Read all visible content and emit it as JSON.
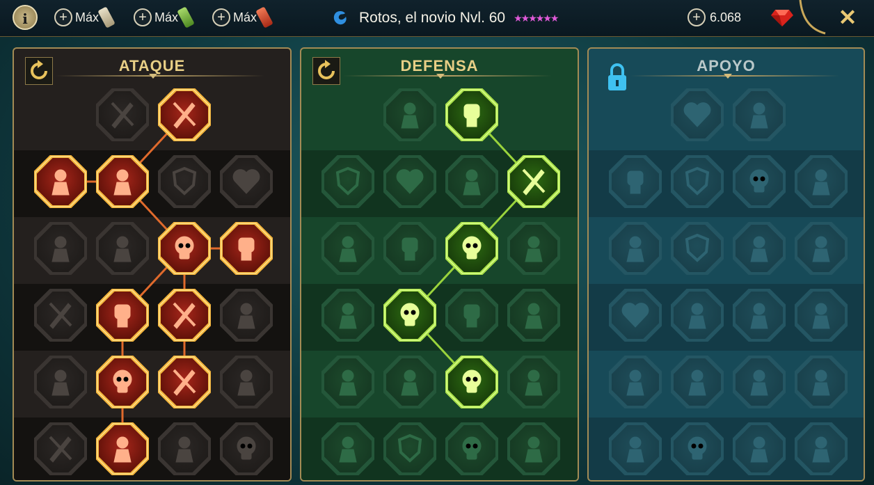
{
  "header": {
    "info_label": "i",
    "resources": [
      {
        "label": "Máx",
        "icon": "scroll-icon",
        "color": "#d8cfb6"
      },
      {
        "label": "Máx",
        "icon": "scroll-icon",
        "color": "#8bc34a"
      },
      {
        "label": "Máx",
        "icon": "scroll-icon",
        "color": "#d9432c"
      }
    ],
    "champion_icon": "affinity-icon",
    "title": "Rotos, el novio Nvl. 60",
    "stars": "★★★★★★",
    "gems": "6.068",
    "gem_icon": "ruby-icon",
    "close_label": "✕"
  },
  "trees": [
    {
      "id": "attack",
      "title": "ATAQUE",
      "has_reset": true,
      "locked": false,
      "accent": "#e06a2c",
      "nodes": [
        {
          "row": 0,
          "col": 1,
          "active": false,
          "icon": "swords-icon"
        },
        {
          "row": 0,
          "col": 2,
          "active": true,
          "icon": "dagger-strike-icon"
        },
        {
          "row": 1,
          "col": 0,
          "active": true,
          "icon": "demon-icon"
        },
        {
          "row": 1,
          "col": 1,
          "active": true,
          "icon": "triple-arrow-icon"
        },
        {
          "row": 1,
          "col": 2,
          "active": false,
          "icon": "shield-break-icon"
        },
        {
          "row": 1,
          "col": 3,
          "active": false,
          "icon": "heart-claw-icon"
        },
        {
          "row": 2,
          "col": 0,
          "active": false,
          "icon": "warrior-icon"
        },
        {
          "row": 2,
          "col": 1,
          "active": false,
          "icon": "fangs-icon"
        },
        {
          "row": 2,
          "col": 2,
          "active": true,
          "icon": "skull-slash-icon"
        },
        {
          "row": 2,
          "col": 3,
          "active": true,
          "icon": "fist-dagger-icon"
        },
        {
          "row": 3,
          "col": 0,
          "active": false,
          "icon": "sword-swirl-icon"
        },
        {
          "row": 3,
          "col": 1,
          "active": true,
          "icon": "fist-sword-icon"
        },
        {
          "row": 3,
          "col": 2,
          "active": true,
          "icon": "axe-icon"
        },
        {
          "row": 3,
          "col": 3,
          "active": false,
          "icon": "chain-lightning-icon"
        },
        {
          "row": 4,
          "col": 0,
          "active": false,
          "icon": "bow-icon"
        },
        {
          "row": 4,
          "col": 1,
          "active": true,
          "icon": "skulls-icon"
        },
        {
          "row": 4,
          "col": 2,
          "active": true,
          "icon": "sword-ring-icon"
        },
        {
          "row": 4,
          "col": 3,
          "active": false,
          "icon": "brute-icon"
        },
        {
          "row": 5,
          "col": 0,
          "active": false,
          "icon": "sword-sparkle-icon"
        },
        {
          "row": 5,
          "col": 1,
          "active": true,
          "icon": "helmet-fire-icon"
        },
        {
          "row": 5,
          "col": 2,
          "active": false,
          "icon": "demon-lord-icon"
        },
        {
          "row": 5,
          "col": 3,
          "active": false,
          "icon": "skull-crown-icon"
        }
      ],
      "links": [
        [
          0,
          2,
          1,
          1
        ],
        [
          1,
          0,
          1,
          1
        ],
        [
          1,
          1,
          2,
          2
        ],
        [
          2,
          2,
          2,
          3
        ],
        [
          2,
          2,
          3,
          1
        ],
        [
          2,
          2,
          3,
          2
        ],
        [
          3,
          1,
          4,
          1
        ],
        [
          3,
          2,
          4,
          2
        ],
        [
          4,
          1,
          5,
          1
        ]
      ]
    },
    {
      "id": "defense",
      "title": "DEFENSA",
      "has_reset": true,
      "locked": false,
      "accent": "#9ad43c",
      "nodes": [
        {
          "row": 0,
          "col": 1,
          "active": false,
          "icon": "wall-icon"
        },
        {
          "row": 0,
          "col": 2,
          "active": true,
          "icon": "fist-icon"
        },
        {
          "row": 1,
          "col": 0,
          "active": false,
          "icon": "chevron-shield-icon"
        },
        {
          "row": 1,
          "col": 1,
          "active": false,
          "icon": "heart-hand-icon"
        },
        {
          "row": 1,
          "col": 2,
          "active": false,
          "icon": "brute-icon"
        },
        {
          "row": 1,
          "col": 3,
          "active": true,
          "icon": "crossed-blades-icon"
        },
        {
          "row": 2,
          "col": 0,
          "active": false,
          "icon": "figure-icon"
        },
        {
          "row": 2,
          "col": 1,
          "active": false,
          "icon": "shield-hand-icon"
        },
        {
          "row": 2,
          "col": 2,
          "active": true,
          "icon": "heart-skull-icon"
        },
        {
          "row": 2,
          "col": 3,
          "active": false,
          "icon": "halo-icon"
        },
        {
          "row": 3,
          "col": 0,
          "active": false,
          "icon": "knight-icon"
        },
        {
          "row": 3,
          "col": 1,
          "active": true,
          "icon": "hourglass-skull-icon"
        },
        {
          "row": 3,
          "col": 2,
          "active": false,
          "icon": "hand-icon"
        },
        {
          "row": 3,
          "col": 3,
          "active": false,
          "icon": "bull-icon"
        },
        {
          "row": 4,
          "col": 0,
          "active": false,
          "icon": "runner-icon"
        },
        {
          "row": 4,
          "col": 1,
          "active": false,
          "icon": "drops-icon"
        },
        {
          "row": 4,
          "col": 2,
          "active": true,
          "icon": "skull-burst-icon"
        },
        {
          "row": 4,
          "col": 3,
          "active": false,
          "icon": "dragon-icon"
        },
        {
          "row": 5,
          "col": 0,
          "active": false,
          "icon": "warrior-icon"
        },
        {
          "row": 5,
          "col": 1,
          "active": false,
          "icon": "shield-icon"
        },
        {
          "row": 5,
          "col": 2,
          "active": false,
          "icon": "skull-icon"
        },
        {
          "row": 5,
          "col": 3,
          "active": false,
          "icon": "muscle-icon"
        }
      ],
      "links": [
        [
          0,
          2,
          1,
          3
        ],
        [
          1,
          3,
          2,
          2
        ],
        [
          2,
          2,
          3,
          1
        ],
        [
          3,
          1,
          4,
          2
        ]
      ]
    },
    {
      "id": "support",
      "title": "APOYO",
      "has_reset": false,
      "locked": true,
      "accent": "#3fb7e0",
      "nodes": [
        {
          "row": 0,
          "col": 1,
          "active": false,
          "icon": "heart-plus-icon"
        },
        {
          "row": 0,
          "col": 2,
          "active": false,
          "icon": "spiral-icon"
        },
        {
          "row": 1,
          "col": 0,
          "active": false,
          "icon": "praying-hands-icon"
        },
        {
          "row": 1,
          "col": 1,
          "active": false,
          "icon": "shield-waves-icon"
        },
        {
          "row": 1,
          "col": 2,
          "active": false,
          "icon": "skull-aura-icon"
        },
        {
          "row": 1,
          "col": 3,
          "active": false,
          "icon": "speed-boot-icon"
        },
        {
          "row": 2,
          "col": 0,
          "active": false,
          "icon": "healer-icon"
        },
        {
          "row": 2,
          "col": 1,
          "active": false,
          "icon": "shield-lightning-icon"
        },
        {
          "row": 2,
          "col": 2,
          "active": false,
          "icon": "crack-icon"
        },
        {
          "row": 2,
          "col": 3,
          "active": false,
          "icon": "fire-figure-icon"
        },
        {
          "row": 3,
          "col": 0,
          "active": false,
          "icon": "heart-chain-icon"
        },
        {
          "row": 3,
          "col": 1,
          "active": false,
          "icon": "comet-icon"
        },
        {
          "row": 3,
          "col": 2,
          "active": false,
          "icon": "book-icon"
        },
        {
          "row": 3,
          "col": 3,
          "active": false,
          "icon": "eyes-icon"
        },
        {
          "row": 4,
          "col": 0,
          "active": false,
          "icon": "compass-icon"
        },
        {
          "row": 4,
          "col": 1,
          "active": false,
          "icon": "boot-icon"
        },
        {
          "row": 4,
          "col": 2,
          "active": false,
          "icon": "eye-icon"
        },
        {
          "row": 4,
          "col": 3,
          "active": false,
          "icon": "bones-icon"
        },
        {
          "row": 5,
          "col": 0,
          "active": false,
          "icon": "potion-icon"
        },
        {
          "row": 5,
          "col": 1,
          "active": false,
          "icon": "skull-icon"
        },
        {
          "row": 5,
          "col": 2,
          "active": false,
          "icon": "fortress-icon"
        },
        {
          "row": 5,
          "col": 3,
          "active": false,
          "icon": "eagle-icon"
        }
      ],
      "links": []
    }
  ]
}
